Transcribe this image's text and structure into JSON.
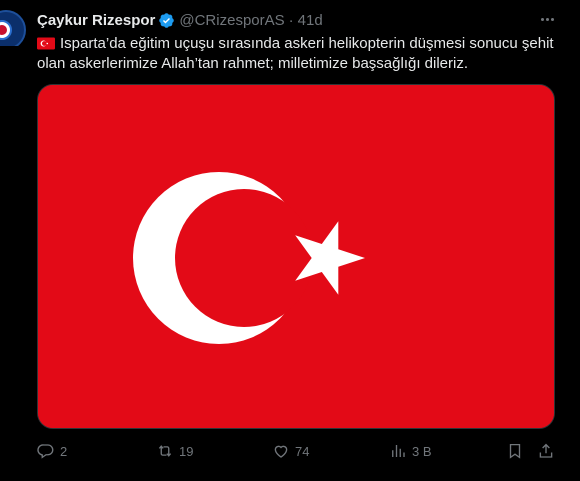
{
  "tweet": {
    "author_name": "Çaykur Rizespor",
    "handle": "@CRizesporAS",
    "separator": "·",
    "time": "41d",
    "text": "Isparta’da eğitim uçuşu sırasında askeri helikopterin düşmesi sonucu şehit olan askerlerimize Allah’tan rahmet; milletimize başsağlığı dileriz.",
    "lead_emoji": "turkey-flag-emoji",
    "media": {
      "description_icon": "turkish-flag",
      "colors": {
        "red": "#e30a17",
        "white": "#ffffff"
      }
    }
  },
  "actions": {
    "reply_count": "2",
    "retweet_count": "19",
    "like_count": "74",
    "views_count": "3 B"
  },
  "colors": {
    "background": "#000000",
    "text_primary": "#e7e9ea",
    "text_secondary": "#71767b",
    "verified_blue": "#1d9bf0"
  }
}
